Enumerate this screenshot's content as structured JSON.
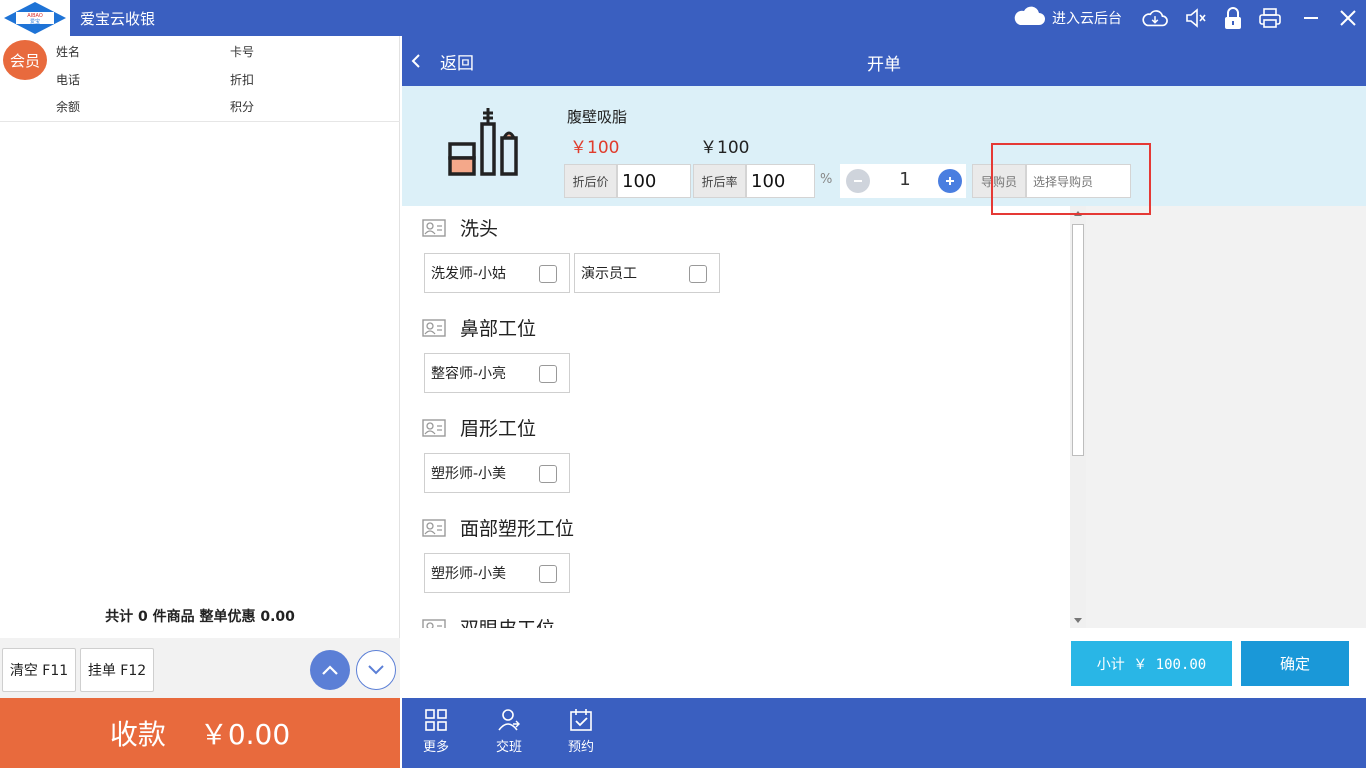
{
  "window": {
    "app_title": "爱宝云收银",
    "logo_text": "AIBAO 爱宝",
    "cloud_link": "进入云后台"
  },
  "member": {
    "avatar_label": "会员",
    "name_label": "姓名",
    "card_label": "卡号",
    "phone_label": "电话",
    "discount_label": "折扣",
    "balance_label": "余额",
    "points_label": "积分"
  },
  "cart": {
    "summary": "共计 0 件商品 整单优惠 0.00",
    "clear_label": "清空 F11",
    "hold_label": "挂单 F12"
  },
  "payment": {
    "label": "收款",
    "amount": "￥0.00"
  },
  "order": {
    "back_label": "返回",
    "title": "开单"
  },
  "product": {
    "name": "腹壁吸脂",
    "original_price": "￥100",
    "price": "￥100",
    "discount_price_label": "折后价",
    "discount_price_value": "100",
    "discount_rate_label": "折后率",
    "discount_rate_value": "100",
    "percent_sign": "%",
    "quantity": "1",
    "guide_label": "导购员",
    "guide_placeholder": "选择导购员"
  },
  "staff_groups": [
    {
      "title": "洗头",
      "members": [
        "洗发师-小姑",
        "演示员工"
      ]
    },
    {
      "title": "鼻部工位",
      "members": [
        "整容师-小亮"
      ]
    },
    {
      "title": "眉形工位",
      "members": [
        "塑形师-小美"
      ]
    },
    {
      "title": "面部塑形工位",
      "members": [
        "塑形师-小美"
      ]
    },
    {
      "title": "双眼皮工位",
      "members": []
    }
  ],
  "footer": {
    "subtotal": "小计 ￥ 100.00",
    "confirm": "确定"
  },
  "nav": {
    "more": "更多",
    "shift": "交班",
    "booking": "预约"
  },
  "colors": {
    "primary_blue": "#3a5fc0",
    "orange": "#e86a3d",
    "price_red": "#e03c2c",
    "subtotal_cyan": "#29b6e6",
    "confirm_blue": "#1a98d8",
    "highlight_red": "#e53935",
    "product_bg": "#dcf0f8"
  }
}
